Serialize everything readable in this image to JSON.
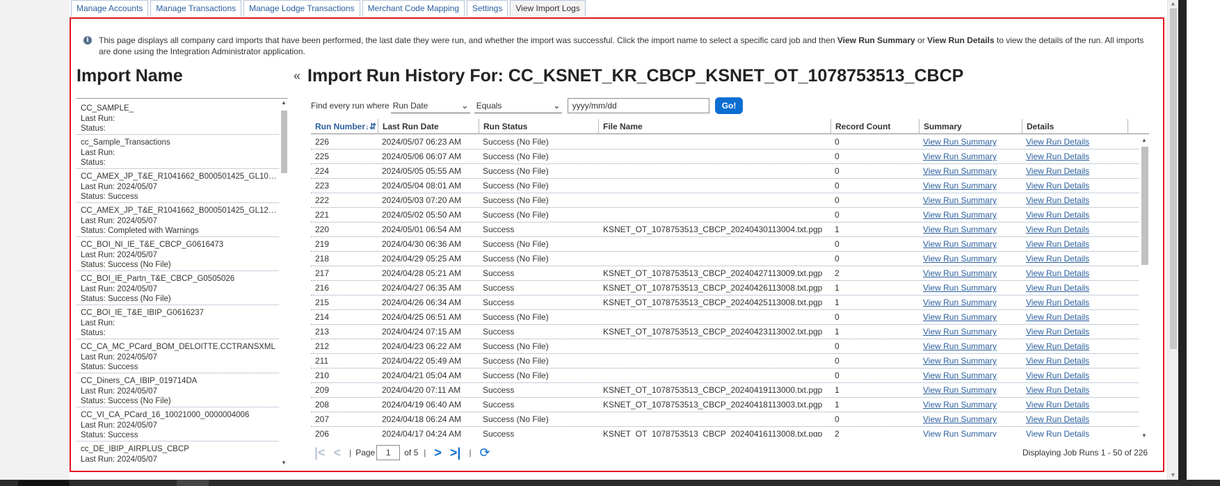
{
  "tabs": [
    "Manage Accounts",
    "Manage Transactions",
    "Manage Lodge Transactions",
    "Merchant Code Mapping",
    "Settings",
    "View Import Logs"
  ],
  "active_tab": "View Import Logs",
  "info": {
    "icon": "info-icon",
    "text_1": "This page displays all company card imports that have been performed, the last date they were run, and whether the import was successful. Click the import name to select a specific card job and then ",
    "bold_1": "View Run Summary",
    "text_2": " or ",
    "bold_2": "View Run Details",
    "text_3": " to view the details of the run. All imports are done using the Integration Administrator application."
  },
  "left_panel": {
    "title": "Import Name",
    "collapse_icon": "«",
    "items": [
      {
        "name": "CC_SAMPLE_",
        "last_run": "Last Run:",
        "status": "Status:"
      },
      {
        "name": "cc_Sample_Transactions",
        "last_run": "Last Run:",
        "status": "Status:"
      },
      {
        "name": "CC_AMEX_JP_T&E_R1041662_B000501425_GL102...",
        "last_run": "Last Run: 2024/05/07",
        "status": "Status: Success"
      },
      {
        "name": "CC_AMEX_JP_T&E_R1041662_B000501425_GL120...",
        "last_run": "Last Run: 2024/05/07",
        "status": "Status: Completed with Warnings"
      },
      {
        "name": "CC_BOI_NI_IE_T&E_CBCP_G0616473",
        "last_run": "Last Run: 2024/05/07",
        "status": "Status: Success (No File)"
      },
      {
        "name": "CC_BOI_IE_Partn_T&E_CBCP_G0505026",
        "last_run": "Last Run: 2024/05/07",
        "status": "Status: Success (No File)"
      },
      {
        "name": "CC_BOI_IE_T&E_IBIP_G0616237",
        "last_run": "Last Run:",
        "status": "Status:"
      },
      {
        "name": "CC_CA_MC_PCard_BOM_DELOITTE.CCTRANSXML",
        "last_run": "Last Run: 2024/05/07",
        "status": "Status: Success"
      },
      {
        "name": "CC_Diners_CA_IBIP_019714DA",
        "last_run": "Last Run: 2024/05/07",
        "status": "Status: Success (No File)"
      },
      {
        "name": "CC_VI_CA_PCard_16_10021000_0000004006",
        "last_run": "Last Run: 2024/05/07",
        "status": "Status: Success"
      },
      {
        "name": "cc_DE_IBIP_AIRPLUS_CBCP",
        "last_run": "Last Run: 2024/05/07",
        "status": ""
      }
    ]
  },
  "right_panel": {
    "title": "Import Run History For: CC_KSNET_KR_CBCP_KSNET_OT_1078753513_CBCP",
    "filter": {
      "label": "Find every run where",
      "field": "Run Date",
      "operator": "Equals",
      "date_placeholder": "yyyy/mm/dd",
      "go": "Go!"
    },
    "columns": [
      "Run Number↓⇵",
      "Last Run Date",
      "Run Status",
      "File Name",
      "Record Count",
      "Summary",
      "Details"
    ],
    "rows": [
      {
        "run": "226",
        "date": "2024/05/07 06:23 AM",
        "status": "Success (No File)",
        "file": "",
        "count": "0",
        "summary": "View Run Summary",
        "details": "View Run Details"
      },
      {
        "run": "225",
        "date": "2024/05/06 06:07 AM",
        "status": "Success (No File)",
        "file": "",
        "count": "0",
        "summary": "View Run Summary",
        "details": "View Run Details"
      },
      {
        "run": "224",
        "date": "2024/05/05 05:55 AM",
        "status": "Success (No File)",
        "file": "",
        "count": "0",
        "summary": "View Run Summary",
        "details": "View Run Details"
      },
      {
        "run": "223",
        "date": "2024/05/04 08:01 AM",
        "status": "Success (No File)",
        "file": "",
        "count": "0",
        "summary": "View Run Summary",
        "details": "View Run Details"
      },
      {
        "run": "222",
        "date": "2024/05/03 07:20 AM",
        "status": "Success (No File)",
        "file": "",
        "count": "0",
        "summary": "View Run Summary",
        "details": "View Run Details"
      },
      {
        "run": "221",
        "date": "2024/05/02 05:50 AM",
        "status": "Success (No File)",
        "file": "",
        "count": "0",
        "summary": "View Run Summary",
        "details": "View Run Details"
      },
      {
        "run": "220",
        "date": "2024/05/01 06:54 AM",
        "status": "Success",
        "file": "KSNET_OT_1078753513_CBCP_20240430113004.txt.pgp",
        "count": "1",
        "summary": "View Run Summary",
        "details": "View Run Details"
      },
      {
        "run": "219",
        "date": "2024/04/30 06:36 AM",
        "status": "Success (No File)",
        "file": "",
        "count": "0",
        "summary": "View Run Summary",
        "details": "View Run Details"
      },
      {
        "run": "218",
        "date": "2024/04/29 05:25 AM",
        "status": "Success (No File)",
        "file": "",
        "count": "0",
        "summary": "View Run Summary",
        "details": "View Run Details"
      },
      {
        "run": "217",
        "date": "2024/04/28 05:21 AM",
        "status": "Success",
        "file": "KSNET_OT_1078753513_CBCP_20240427113009.txt.pgp",
        "count": "2",
        "summary": "View Run Summary",
        "details": "View Run Details"
      },
      {
        "run": "216",
        "date": "2024/04/27 06:35 AM",
        "status": "Success",
        "file": "KSNET_OT_1078753513_CBCP_20240426113008.txt.pgp",
        "count": "1",
        "summary": "View Run Summary",
        "details": "View Run Details"
      },
      {
        "run": "215",
        "date": "2024/04/26 06:34 AM",
        "status": "Success",
        "file": "KSNET_OT_1078753513_CBCP_20240425113008.txt.pgp",
        "count": "1",
        "summary": "View Run Summary",
        "details": "View Run Details"
      },
      {
        "run": "214",
        "date": "2024/04/25 06:51 AM",
        "status": "Success (No File)",
        "file": "",
        "count": "0",
        "summary": "View Run Summary",
        "details": "View Run Details"
      },
      {
        "run": "213",
        "date": "2024/04/24 07:15 AM",
        "status": "Success",
        "file": "KSNET_OT_1078753513_CBCP_20240423113002.txt.pgp",
        "count": "1",
        "summary": "View Run Summary",
        "details": "View Run Details"
      },
      {
        "run": "212",
        "date": "2024/04/23 06:22 AM",
        "status": "Success (No File)",
        "file": "",
        "count": "0",
        "summary": "View Run Summary",
        "details": "View Run Details"
      },
      {
        "run": "211",
        "date": "2024/04/22 05:49 AM",
        "status": "Success (No File)",
        "file": "",
        "count": "0",
        "summary": "View Run Summary",
        "details": "View Run Details"
      },
      {
        "run": "210",
        "date": "2024/04/21 05:04 AM",
        "status": "Success (No File)",
        "file": "",
        "count": "0",
        "summary": "View Run Summary",
        "details": "View Run Details"
      },
      {
        "run": "209",
        "date": "2024/04/20 07:11 AM",
        "status": "Success",
        "file": "KSNET_OT_1078753513_CBCP_20240419113000.txt.pgp",
        "count": "1",
        "summary": "View Run Summary",
        "details": "View Run Details"
      },
      {
        "run": "208",
        "date": "2024/04/19 06:40 AM",
        "status": "Success",
        "file": "KSNET_OT_1078753513_CBCP_20240418113003.txt.pgp",
        "count": "1",
        "summary": "View Run Summary",
        "details": "View Run Details"
      },
      {
        "run": "207",
        "date": "2024/04/18 06:24 AM",
        "status": "Success (No File)",
        "file": "",
        "count": "0",
        "summary": "View Run Summary",
        "details": "View Run Details"
      },
      {
        "run": "206",
        "date": "2024/04/17 04:24 AM",
        "status": "Success",
        "file": "KSNET_OT_1078753513_CBCP_20240416113008.txt.pgp",
        "count": "2",
        "summary": "View Run Summary",
        "details": "View Run Details"
      }
    ],
    "pager": {
      "page_label": "Page",
      "page_value": "1",
      "of_label": "of 5",
      "displaying": "Displaying Job Runs 1 - 50 of 226"
    }
  },
  "colors": {
    "panel_border": "#e0141e",
    "link": "#2a5f9e",
    "accent": "#0a6ed1"
  }
}
